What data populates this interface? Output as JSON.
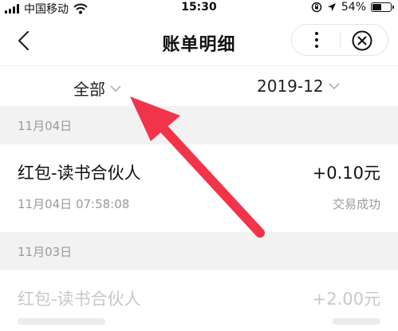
{
  "status_bar": {
    "carrier": "中国移动",
    "time": "15:30",
    "battery_percent": "54%",
    "battery_level": 0.54
  },
  "nav": {
    "title": "账单明细",
    "back_icon": "chevron-left-icon",
    "more_icon": "more-vertical-icon",
    "close_icon": "close-circle-icon"
  },
  "filters": {
    "type": "全部",
    "month": "2019-12"
  },
  "groups": [
    {
      "date": "11月04日",
      "items": [
        {
          "title": "红包-读书合伙人",
          "amount": "+0.10元",
          "time": "11月04日 07:58:08",
          "status": "交易成功"
        }
      ]
    },
    {
      "date": "11月03日",
      "items": [
        {
          "title": "红包-读书合伙人",
          "amount": "+2.00元"
        }
      ]
    }
  ],
  "colors": {
    "annotation_arrow": "#f2344a",
    "section_background": "#f2f2f2",
    "secondary_text": "#9a9a9a"
  }
}
